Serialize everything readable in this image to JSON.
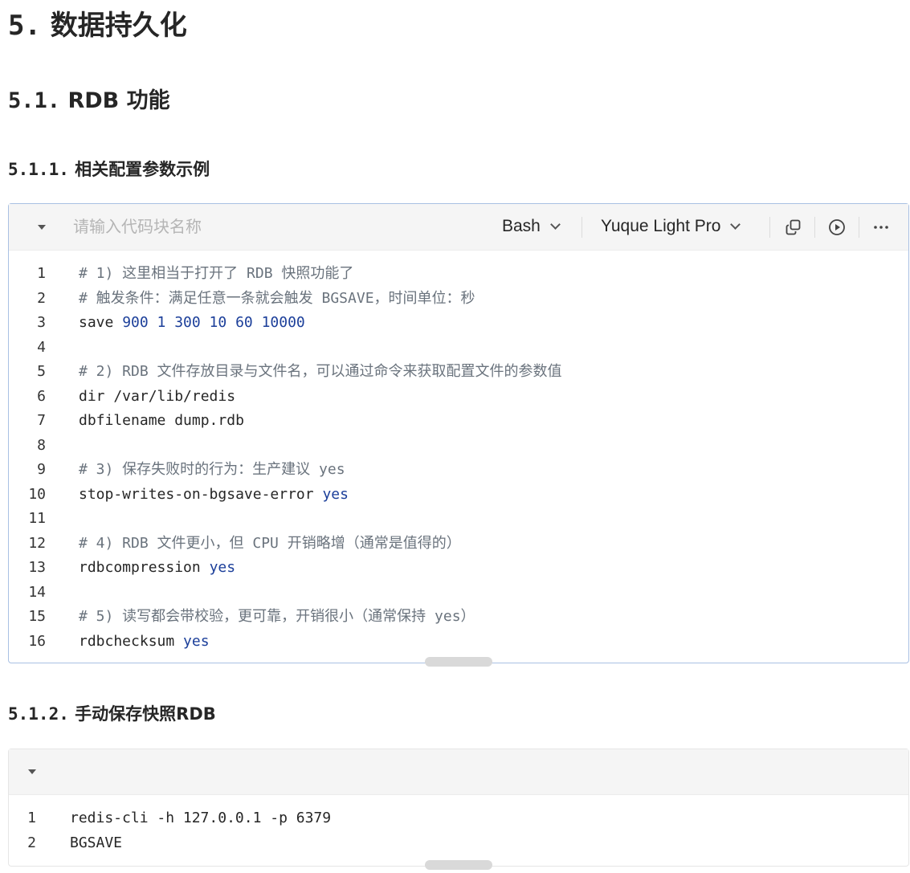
{
  "heading_5": {
    "num": "5.",
    "text": "数据持久化"
  },
  "heading_5_1": {
    "num": "5.1.",
    "text": "RDB 功能"
  },
  "heading_5_1_1": {
    "num": "5.1.1.",
    "text": "相关配置参数示例"
  },
  "heading_5_1_2": {
    "num": "5.1.2.",
    "text": "手动保存快照RDB"
  },
  "code_block_1": {
    "name_placeholder": "请输入代码块名称",
    "language": "Bash",
    "theme": "Yuque Light Pro",
    "icons": {
      "collapse": "caret-down-icon",
      "language": "chevron-down-icon",
      "theme": "chevron-down-icon",
      "copy": "copy-icon",
      "run": "play-circle-icon",
      "more": "more-icon"
    },
    "lines": [
      {
        "n": "1",
        "parts": [
          {
            "t": "# 1) 这里相当于打开了 RDB 快照功能了",
            "c": "comment"
          }
        ]
      },
      {
        "n": "2",
        "parts": [
          {
            "t": "# 触发条件：满足任意一条就会触发 BGSAVE，时间单位：秒",
            "c": "comment"
          }
        ]
      },
      {
        "n": "3",
        "parts": [
          {
            "t": "save ",
            "c": "plain"
          },
          {
            "t": "900 1 300 10 60 10000",
            "c": "num"
          }
        ]
      },
      {
        "n": "4",
        "parts": []
      },
      {
        "n": "5",
        "parts": [
          {
            "t": "# 2) RDB 文件存放目录与文件名，可以通过命令来获取配置文件的参数值",
            "c": "comment"
          }
        ]
      },
      {
        "n": "6",
        "parts": [
          {
            "t": "dir /var/lib/redis",
            "c": "plain"
          }
        ]
      },
      {
        "n": "7",
        "parts": [
          {
            "t": "dbfilename dump.rdb",
            "c": "plain"
          }
        ]
      },
      {
        "n": "8",
        "parts": []
      },
      {
        "n": "9",
        "parts": [
          {
            "t": "# 3) 保存失败时的行为：生产建议 yes",
            "c": "comment"
          }
        ]
      },
      {
        "n": "10",
        "parts": [
          {
            "t": "stop-writes-on-bgsave-error ",
            "c": "plain"
          },
          {
            "t": "yes",
            "c": "kw"
          }
        ]
      },
      {
        "n": "11",
        "parts": []
      },
      {
        "n": "12",
        "parts": [
          {
            "t": "# 4) RDB 文件更小，但 CPU 开销略增（通常是值得的）",
            "c": "comment"
          }
        ]
      },
      {
        "n": "13",
        "parts": [
          {
            "t": "rdbcompression ",
            "c": "plain"
          },
          {
            "t": "yes",
            "c": "kw"
          }
        ]
      },
      {
        "n": "14",
        "parts": []
      },
      {
        "n": "15",
        "parts": [
          {
            "t": "# 5) 读写都会带校验，更可靠，开销很小（通常保持 yes）",
            "c": "comment"
          }
        ]
      },
      {
        "n": "16",
        "parts": [
          {
            "t": "rdbchecksum ",
            "c": "plain"
          },
          {
            "t": "yes",
            "c": "kw"
          }
        ]
      }
    ]
  },
  "code_block_2": {
    "icons": {
      "collapse": "caret-down-icon"
    },
    "lines": [
      {
        "n": "1",
        "parts": [
          {
            "t": "redis-cli -h 127.0.0.1 -p 6379",
            "c": "plain"
          }
        ]
      },
      {
        "n": "2",
        "parts": [
          {
            "t": "BGSAVE",
            "c": "plain"
          }
        ]
      }
    ]
  },
  "colors": {
    "comment": "#6a737d",
    "number": "#1c3f9a",
    "keyword": "#1c3f9a",
    "active_border": "#a9c0e3",
    "toolbar_bg": "#f5f5f5"
  }
}
